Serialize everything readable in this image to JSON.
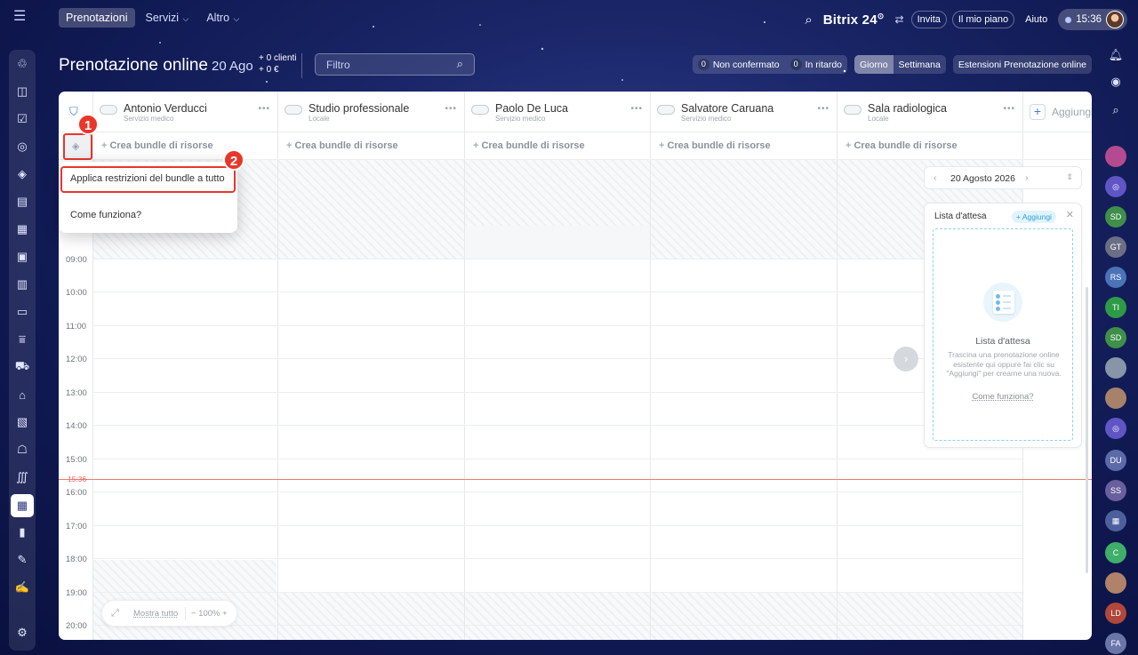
{
  "topbar": {
    "nav": [
      {
        "label": "Prenotazioni",
        "active": true,
        "dropdown": false
      },
      {
        "label": "Servizi",
        "active": false,
        "dropdown": true
      },
      {
        "label": "Altro",
        "active": false,
        "dropdown": true
      }
    ],
    "brand": "Bitrix 24",
    "invite": "Invita",
    "plan": "Il mio piano",
    "help": "Aiuto",
    "time": "15:36"
  },
  "header": {
    "title": "Prenotazione online",
    "date": "20 Ago",
    "clients": "+ 0 clienti",
    "money": "+ 0 €",
    "filter_placeholder": "Filtro",
    "unconfirmed_count": "0",
    "unconfirmed_label": "Non confermato",
    "late_count": "0",
    "late_label": "In ritardo",
    "view_day": "Giorno",
    "view_week": "Settimana",
    "extensions": "Estensioni Prenotazione online"
  },
  "resources": [
    {
      "name": "Antonio Verducci",
      "type": "Servizio medico"
    },
    {
      "name": "Studio professionale",
      "type": "Locale"
    },
    {
      "name": "Paolo De Luca",
      "type": "Servizio medico"
    },
    {
      "name": "Salvatore Caruana",
      "type": "Servizio medico"
    },
    {
      "name": "Sala radiologica",
      "type": "Locale"
    }
  ],
  "add_resource": "Aggiungi",
  "bundle_label": "Crea bundle di risorse",
  "hours": [
    "09:00",
    "10:00",
    "11:00",
    "12:00",
    "13:00",
    "14:00",
    "15:00",
    "16:00",
    "17:00",
    "18:00",
    "19:00",
    "20:00"
  ],
  "now_time": "15:36",
  "menu": {
    "item1": "Applica restrizioni del bundle a tutto",
    "item2": "Come funziona?"
  },
  "badges": {
    "one": "1",
    "two": "2"
  },
  "waitlist": {
    "date": "20 Agosto 2026",
    "title": "Lista d'attesa",
    "add": "+ Aggiungi",
    "empty_title": "Lista d'attesa",
    "empty_desc": "Trascina una prenotazione online esistente qui oppure fai clic su \"Aggiungi\" per crearne una nuova.",
    "how_link": "Come funziona?"
  },
  "zoom": {
    "show_all": "Mostra tutto",
    "level": "100%"
  },
  "right_sidebar_avatars": [
    "SD",
    "GT",
    "RS",
    "TI",
    "SD",
    "DU",
    "SS",
    "C",
    "LD",
    "FA"
  ],
  "colors": {
    "accent_red": "#e8362b",
    "link_blue": "#3e7ad6",
    "now_line": "#ef7b6b"
  }
}
